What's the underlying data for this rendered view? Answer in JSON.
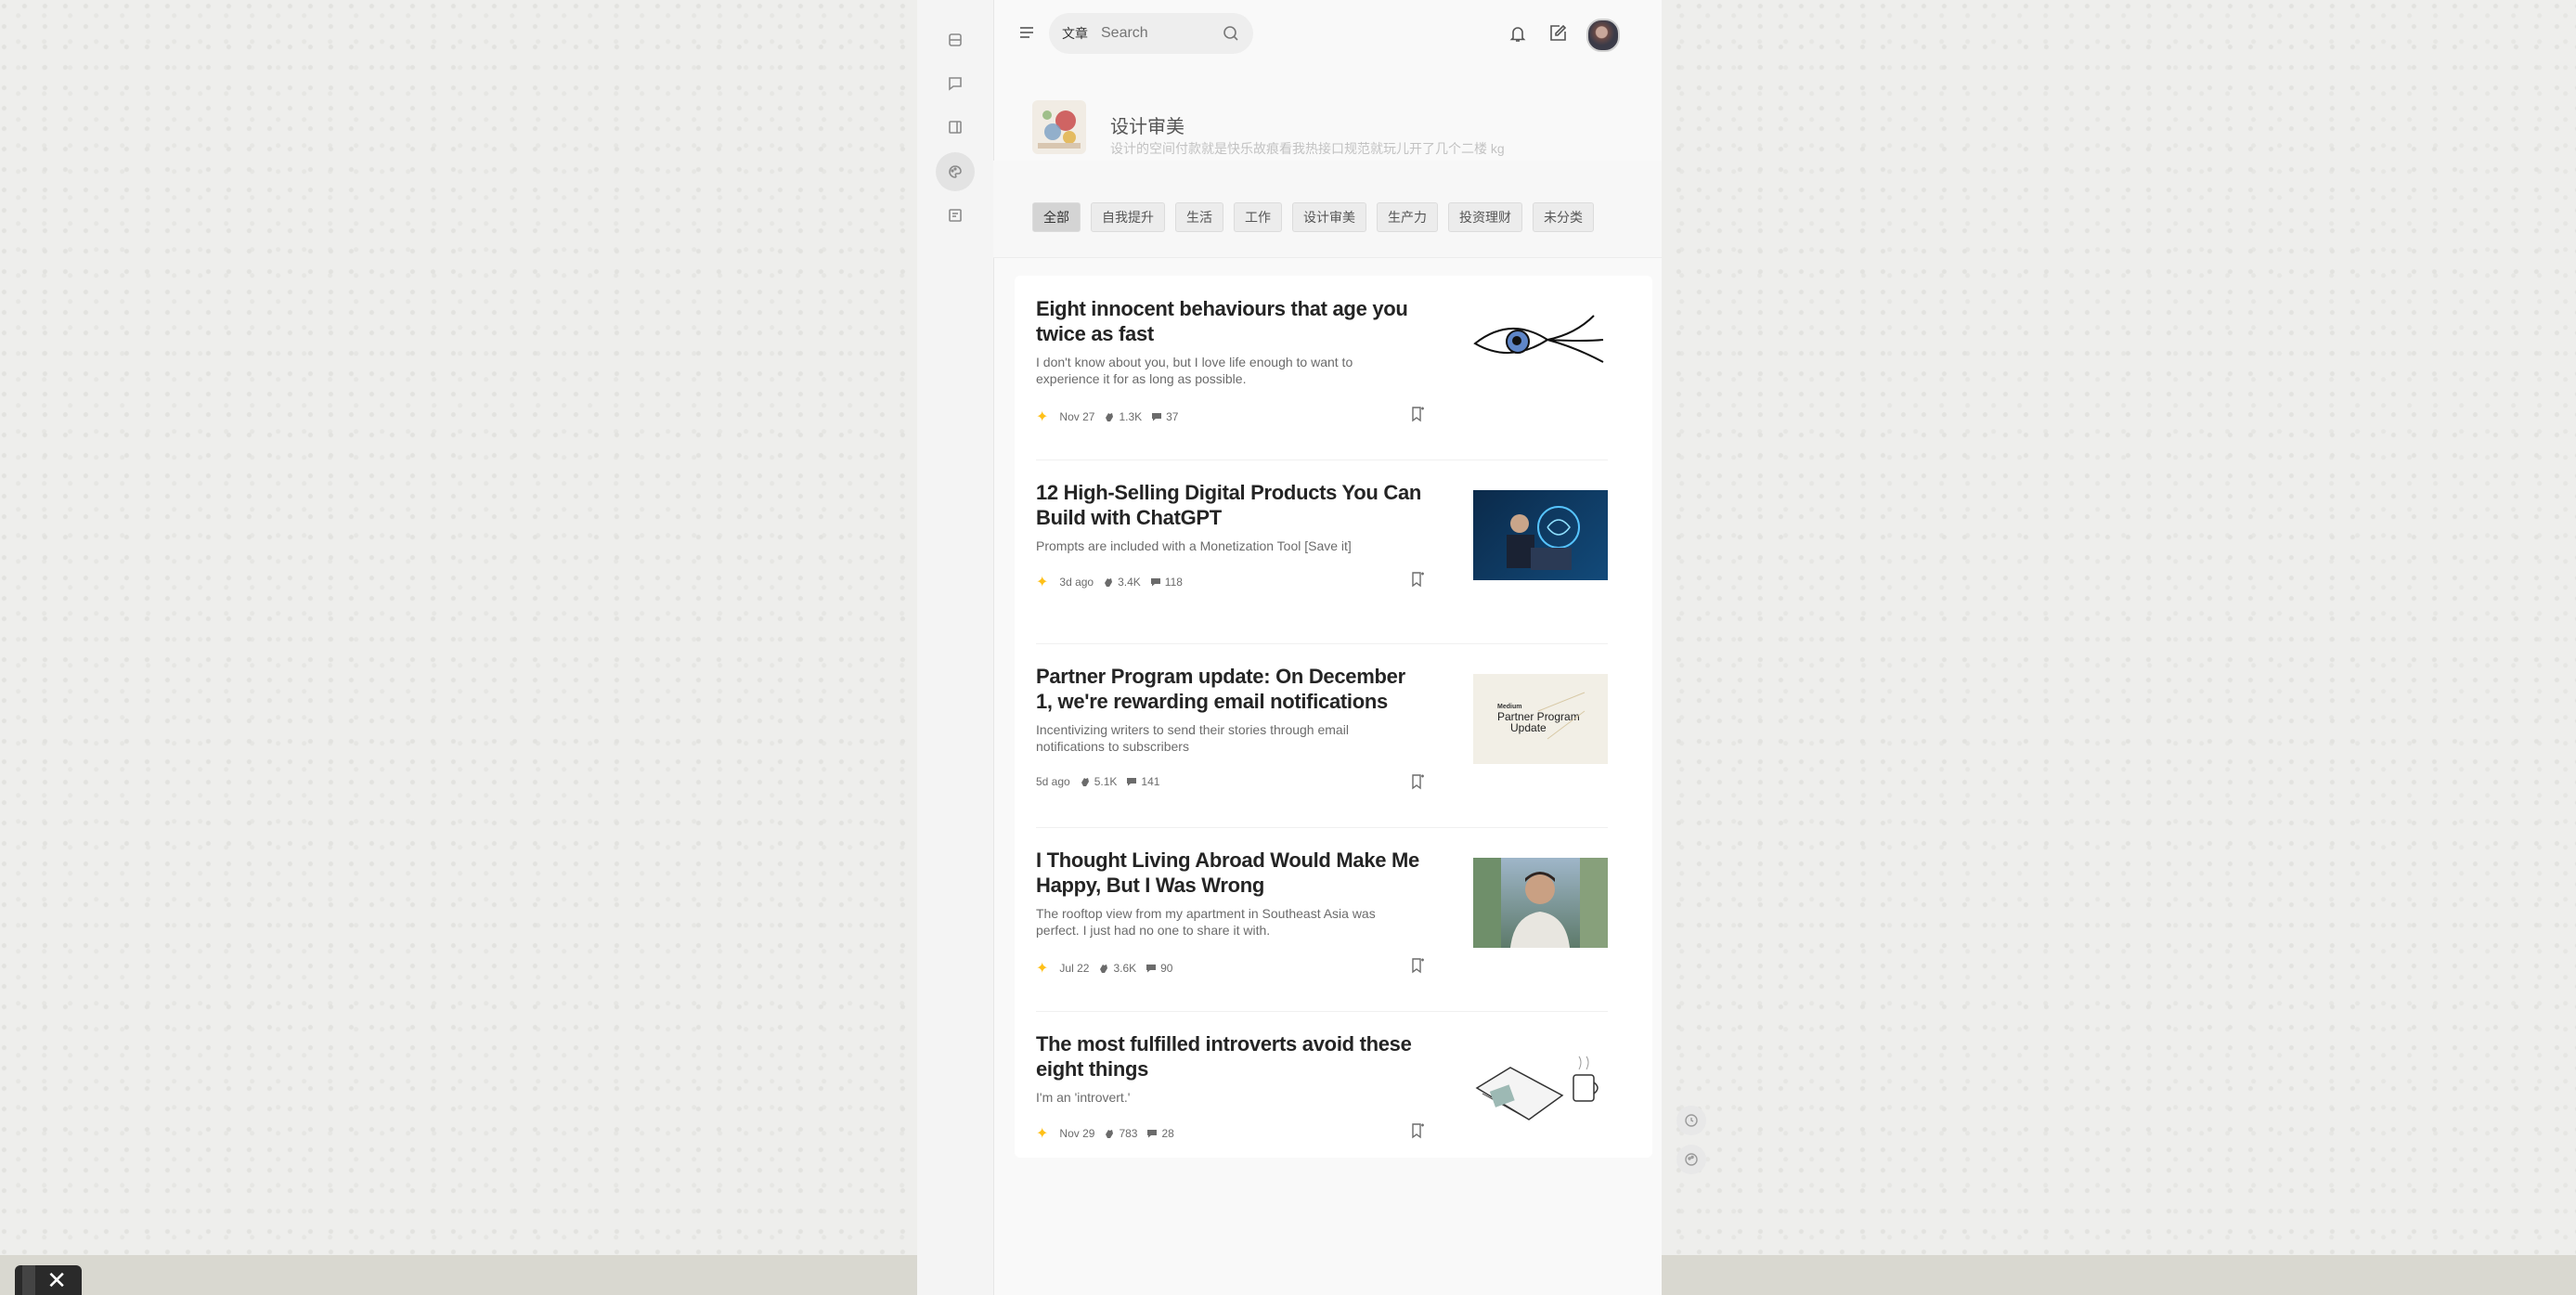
{
  "topbar": {
    "search_tag": "文章",
    "search_placeholder": "Search"
  },
  "category": {
    "title": "设计审美",
    "description": "设计的空间付款就是快乐故痕看我热接口规范就玩儿开了几个二楼 kg"
  },
  "tabs": [
    "全部",
    "自我提升",
    "生活",
    "工作",
    "设计审美",
    "生产力",
    "投资理财",
    "未分类"
  ],
  "active_tab": "全部",
  "articles": [
    {
      "title": "Eight innocent behaviours that age you twice as fast",
      "subtitle": "I don't know about you, but I love life enough to want to experience it for as long as possible.",
      "date": "Nov 27",
      "claps": "1.3K",
      "comments": "37",
      "member": true
    },
    {
      "title": "12 High-Selling Digital Products You Can Build with ChatGPT",
      "subtitle": "Prompts are included with a Monetization Tool [Save it]",
      "date": "3d ago",
      "claps": "3.4K",
      "comments": "118",
      "member": true
    },
    {
      "title": "Partner Program update: On December 1, we're rewarding email notifications",
      "subtitle": "Incentivizing writers to send their stories through email notifications to subscribers",
      "date": "5d ago",
      "claps": "5.1K",
      "comments": "141",
      "member": false,
      "thumb_text": [
        "Medium",
        "Partner Program",
        "Update"
      ]
    },
    {
      "title": "I Thought Living Abroad Would Make Me Happy, But I Was Wrong",
      "subtitle": "The rooftop view from my apartment in Southeast Asia was perfect. I just had no one to share it with.",
      "date": "Jul 22",
      "claps": "3.6K",
      "comments": "90",
      "member": true
    },
    {
      "title": "The most fulfilled introverts avoid these eight things",
      "subtitle": "I'm an 'introvert.'",
      "date": "Nov 29",
      "claps": "783",
      "comments": "28",
      "member": true
    }
  ],
  "colors": {
    "member_star": "#ffc017",
    "accent_gray": "#242424"
  }
}
